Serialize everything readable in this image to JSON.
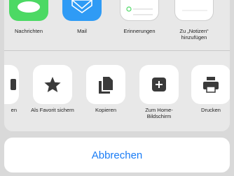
{
  "colors": {
    "accent": "#1a7cf5",
    "messages_green": "#4cd964",
    "mail_blue": "#2f9bf5",
    "sheet_background": "#e8e8e8",
    "icon_dark": "#3a3a3a"
  },
  "apps_row": [
    {
      "label": "Nachrichten",
      "icon": "messages-icon"
    },
    {
      "label": "Mail",
      "icon": "mail-icon"
    },
    {
      "label": "Erinnerungen",
      "icon": "reminders-icon"
    },
    {
      "label": "Zu „Notizen“ hinzufügen",
      "icon": "notes-icon"
    }
  ],
  "actions_row": [
    {
      "label": "en",
      "icon": "partial-action-icon"
    },
    {
      "label": "Als Favorit sichern",
      "icon": "star-icon"
    },
    {
      "label": "Kopieren",
      "icon": "copy-icon"
    },
    {
      "label": "Zum Home-Bildschirm",
      "icon": "add-to-home-icon"
    },
    {
      "label": "Drucken",
      "icon": "print-icon"
    }
  ],
  "cancel_button": {
    "label": "Abbrechen"
  }
}
